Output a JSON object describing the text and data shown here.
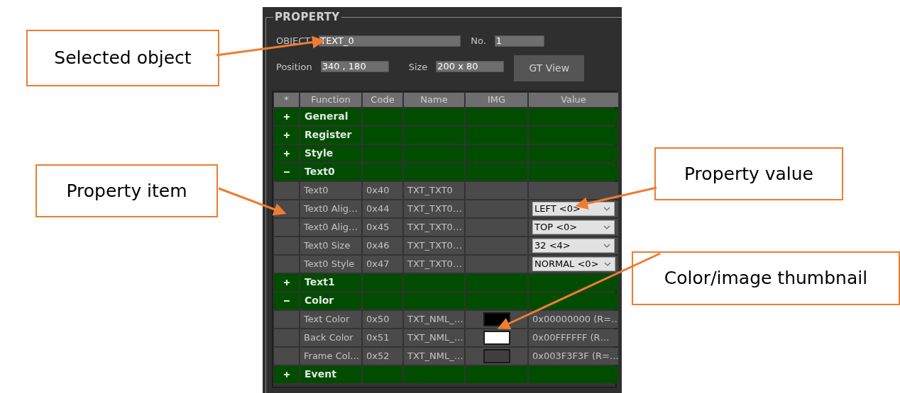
{
  "panel": {
    "title": "PROPERTY",
    "object": {
      "label": "OBJECT",
      "value": "TEXT_0"
    },
    "number": {
      "label": "No.",
      "value": "1"
    },
    "position": {
      "label": "Position",
      "value": "340 , 180"
    },
    "size": {
      "label": "Size",
      "value": "200 x 80"
    },
    "button": "GT View"
  },
  "table": {
    "columns": [
      "*",
      "Function",
      "Code",
      "Name",
      "IMG",
      "Value"
    ],
    "rows": [
      {
        "kind": "group",
        "label": "General",
        "expanded": false
      },
      {
        "kind": "group",
        "label": "Register",
        "expanded": false
      },
      {
        "kind": "group",
        "label": "Style",
        "expanded": false
      },
      {
        "kind": "group",
        "label": "Text0",
        "expanded": true
      },
      {
        "kind": "text",
        "function": "Text0",
        "code": "0x40",
        "name": "TXT_TXT0"
      },
      {
        "kind": "dropdown",
        "function": "Text0 Alig…",
        "code": "0x44",
        "name": "TXT_TXT0…",
        "value": "LEFT <0>"
      },
      {
        "kind": "dropdown",
        "function": "Text0 Alig…",
        "code": "0x45",
        "name": "TXT_TXT0…",
        "value": "TOP <0>"
      },
      {
        "kind": "dropdown",
        "function": "Text0 Size",
        "code": "0x46",
        "name": "TXT_TXT0…",
        "value": "32 <4>"
      },
      {
        "kind": "dropdown",
        "function": "Text0 Style",
        "code": "0x47",
        "name": "TXT_TXT0…",
        "value": "NORMAL <0>"
      },
      {
        "kind": "group",
        "label": "Text1",
        "expanded": false
      },
      {
        "kind": "group",
        "label": "Color",
        "expanded": true
      },
      {
        "kind": "color",
        "function": "Text Color",
        "code": "0x50",
        "name": "TXT_NML_…",
        "color": "#000000",
        "value": "0x00000000 (R=…"
      },
      {
        "kind": "color",
        "function": "Back Color",
        "code": "0x51",
        "name": "TXT_NML_…",
        "color": "#ffffff",
        "value": "0x00FFFFFF (R…"
      },
      {
        "kind": "color",
        "function": "Frame Col…",
        "code": "0x52",
        "name": "TXT_NML_…",
        "color": "#3f3f3f",
        "value": "0x003F3F3F (R=…"
      },
      {
        "kind": "group",
        "label": "Event",
        "expanded": false
      }
    ]
  },
  "callouts": [
    {
      "text": "Selected object"
    },
    {
      "text": "Property item"
    },
    {
      "text": "Property value"
    },
    {
      "text": "Color/image thumbnail"
    }
  ]
}
